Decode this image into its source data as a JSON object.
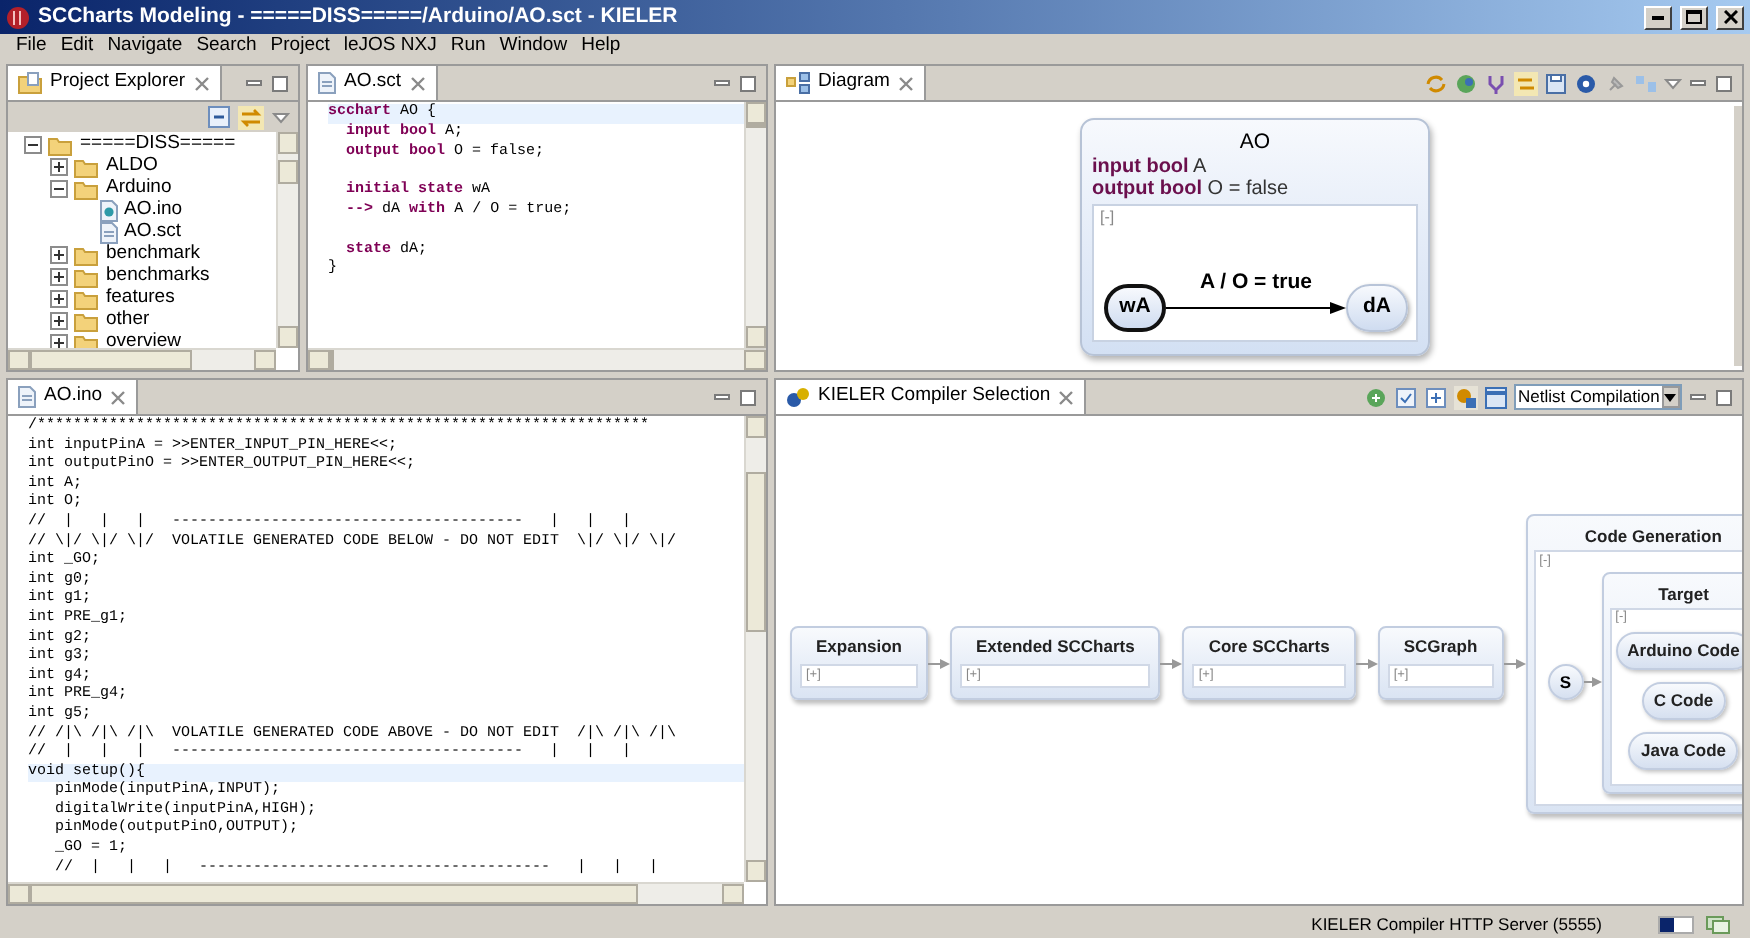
{
  "window": {
    "title": "SCCharts Modeling - =====DISS=====/Arduino/AO.sct - KIELER"
  },
  "menu": [
    "File",
    "Edit",
    "Navigate",
    "Search",
    "Project",
    "leJOS NXJ",
    "Run",
    "Window",
    "Help"
  ],
  "project_explorer": {
    "tab": "Project Explorer",
    "tree": [
      {
        "label": "=====DISS=====",
        "kind": "project",
        "expanded": true,
        "children": [
          {
            "label": "ALDO",
            "kind": "folder",
            "expanded": false
          },
          {
            "label": "Arduino",
            "kind": "folder",
            "expanded": true,
            "children": [
              {
                "label": "AO.ino",
                "kind": "ino"
              },
              {
                "label": "AO.sct",
                "kind": "sct"
              }
            ]
          },
          {
            "label": "benchmark",
            "kind": "folder",
            "expanded": false
          },
          {
            "label": "benchmarks",
            "kind": "folder",
            "expanded": false
          },
          {
            "label": "features",
            "kind": "folder",
            "expanded": false
          },
          {
            "label": "other",
            "kind": "folder",
            "expanded": false
          },
          {
            "label": "overview",
            "kind": "folder",
            "expanded": false
          }
        ]
      }
    ]
  },
  "sct_editor": {
    "tab": "AO.sct",
    "lines": [
      {
        "kind": "current",
        "text": "**scchart** AO {"
      },
      {
        "kind": "code",
        "text": "  **input bool** A;"
      },
      {
        "kind": "code",
        "text": "  **output bool** O = false;"
      },
      {
        "kind": "blank"
      },
      {
        "kind": "fold",
        "text": "  **initial state** wA"
      },
      {
        "kind": "code",
        "text": "  **-->** dA **with** A / O = true;"
      },
      {
        "kind": "blank"
      },
      {
        "kind": "code",
        "text": "  **state** dA;"
      },
      {
        "kind": "code",
        "text": "}"
      }
    ]
  },
  "diagram": {
    "tab": "Diagram",
    "chart": {
      "name": "AO",
      "declarations": [
        "**input bool** A",
        "**output bool** O = false"
      ],
      "region": "[-]",
      "transition": "A / O = true",
      "states": [
        {
          "label": "wA",
          "initial": true
        },
        {
          "label": "dA",
          "initial": false
        }
      ]
    }
  },
  "ino_editor": {
    "tab": "AO.ino",
    "lines": [
      {
        "kind": "code",
        "text": "/********************************************************************"
      },
      {
        "kind": "code",
        "text": "int inputPinA = >>ENTER_INPUT_PIN_HERE<<;"
      },
      {
        "kind": "code",
        "text": "int outputPinO = >>ENTER_OUTPUT_PIN_HERE<<;"
      },
      {
        "kind": "code",
        "text": "int A;"
      },
      {
        "kind": "code",
        "text": "int O;"
      },
      {
        "kind": "code",
        "text": "//  |   |   |   ---------------------------------------   |   |   |"
      },
      {
        "kind": "code",
        "text": "// \\|/ \\|/ \\|/  VOLATILE GENERATED CODE BELOW - DO NOT EDIT  \\|/ \\|/ \\|/"
      },
      {
        "kind": "code",
        "text": "int _GO;"
      },
      {
        "kind": "code",
        "text": "int g0;"
      },
      {
        "kind": "code",
        "text": "int g1;"
      },
      {
        "kind": "code",
        "text": "int PRE_g1;"
      },
      {
        "kind": "code",
        "text": "int g2;"
      },
      {
        "kind": "code",
        "text": "int g3;"
      },
      {
        "kind": "code",
        "text": "int g4;"
      },
      {
        "kind": "code",
        "text": "int PRE_g4;"
      },
      {
        "kind": "code",
        "text": "int g5;"
      },
      {
        "kind": "code",
        "text": "// /|\\ /|\\ /|\\  VOLATILE GENERATED CODE ABOVE - DO NOT EDIT  /|\\ /|\\ /|\\"
      },
      {
        "kind": "code",
        "text": "//  |   |   |   ---------------------------------------   |   |   |"
      },
      {
        "kind": "current",
        "text": "void setup(){"
      },
      {
        "kind": "code",
        "text": "   pinMode(inputPinA,INPUT);"
      },
      {
        "kind": "code",
        "text": "   digitalWrite(inputPinA,HIGH);"
      },
      {
        "kind": "code",
        "text": "   pinMode(outputPinO,OUTPUT);"
      },
      {
        "kind": "code",
        "text": "   _GO = 1;"
      },
      {
        "kind": "code",
        "text": "   //  |   |   |   ---------------------------------------   |   |   |"
      }
    ]
  },
  "compiler": {
    "tab": "KIELER Compiler Selection",
    "dropdown": "Netlist Compilation",
    "stages": [
      {
        "label": "Expansion",
        "toggle": "[+]"
      },
      {
        "label": "Extended SCCharts",
        "toggle": "[+]"
      },
      {
        "label": "Core SCCharts",
        "toggle": "[+]"
      },
      {
        "label": "SCGraph",
        "toggle": "[+]"
      }
    ],
    "code_generation": {
      "label": "Code Generation",
      "toggle": "[-]",
      "start": "S",
      "target": {
        "label": "Target",
        "toggle": "[-]",
        "options": [
          "Arduino Code",
          "C Code",
          "Java Code"
        ]
      }
    }
  },
  "status_bar": {
    "text": "KIELER Compiler HTTP Server (5555)"
  }
}
